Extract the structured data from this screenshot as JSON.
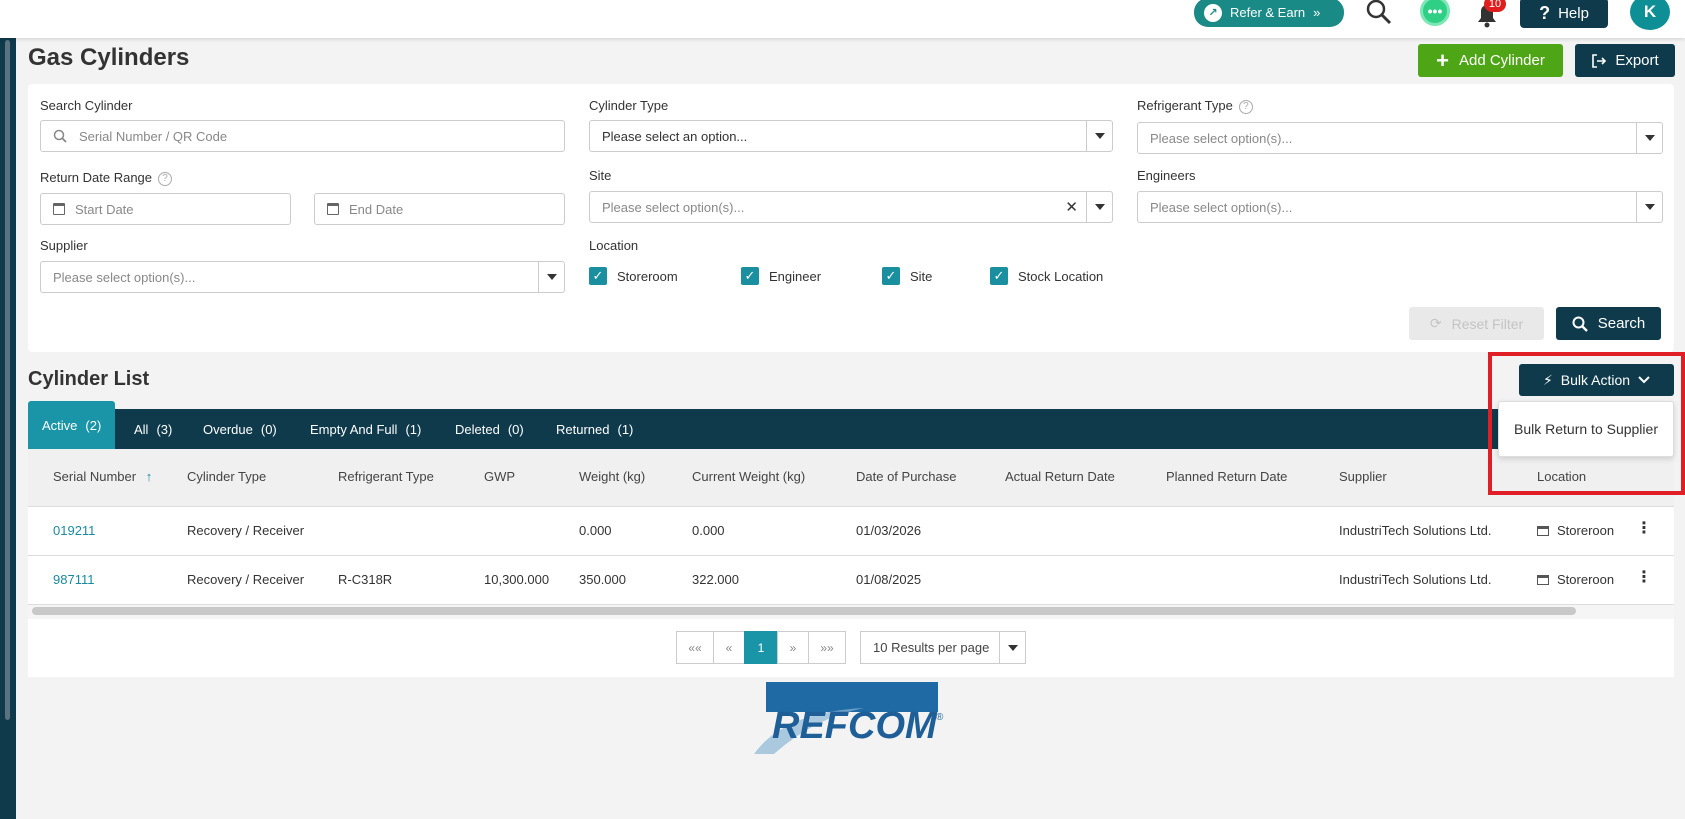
{
  "topbar": {
    "refer_label": "Refer & Earn",
    "refer_chevron": "»",
    "notification_count": "10",
    "help_label": "Help",
    "avatar_initial": "K"
  },
  "page": {
    "title": "Gas Cylinders",
    "add_label": "Add Cylinder",
    "export_label": "Export"
  },
  "filters": {
    "search_label": "Search Cylinder",
    "search_placeholder": "Serial Number / QR Code",
    "cylinder_type_label": "Cylinder Type",
    "cylinder_type_placeholder": "Please select an option...",
    "refrigerant_type_label": "Refrigerant Type",
    "refrigerant_type_placeholder": "Please select option(s)...",
    "return_date_label": "Return Date Range",
    "start_date_placeholder": "Start Date",
    "end_date_placeholder": "End Date",
    "site_label": "Site",
    "site_placeholder": "Please select option(s)...",
    "engineers_label": "Engineers",
    "engineers_placeholder": "Please select option(s)...",
    "supplier_label": "Supplier",
    "supplier_placeholder": "Please select option(s)...",
    "location_label": "Location",
    "locations": [
      "Storeroom",
      "Engineer",
      "Site",
      "Stock Location"
    ],
    "reset_label": "Reset Filter",
    "search_button_label": "Search"
  },
  "list": {
    "title": "Cylinder List",
    "bulk_action_label": "Bulk Action",
    "bulk_menu_item": "Bulk Return to Supplier",
    "tabs": [
      {
        "label": "Active",
        "count": "(2)"
      },
      {
        "label": "All",
        "count": "(3)"
      },
      {
        "label": "Overdue",
        "count": "(0)"
      },
      {
        "label": "Empty And Full",
        "count": "(1)"
      },
      {
        "label": "Deleted",
        "count": "(0)"
      },
      {
        "label": "Returned",
        "count": "(1)"
      }
    ],
    "columns": [
      "Serial Number",
      "Cylinder Type",
      "Refrigerant Type",
      "GWP",
      "Weight (kg)",
      "Current Weight (kg)",
      "Date of Purchase",
      "Actual Return Date",
      "Planned Return Date",
      "Supplier",
      "Location"
    ],
    "rows": [
      {
        "serial": "019211",
        "cylinder_type": "Recovery / Receiver",
        "refrigerant": "",
        "gwp": "",
        "weight": "0.000",
        "current_weight": "0.000",
        "purchase_date": "01/03/2026",
        "actual_return": "",
        "planned_return": "",
        "supplier": "IndustriTech Solutions Ltd.",
        "location": "Storeroon"
      },
      {
        "serial": "987111",
        "cylinder_type": "Recovery / Receiver",
        "refrigerant": "R-C318R",
        "gwp": "10,300.000",
        "weight": "350.000",
        "current_weight": "322.000",
        "purchase_date": "01/08/2025",
        "actual_return": "",
        "planned_return": "",
        "supplier": "IndustriTech Solutions Ltd.",
        "location": "Storeroon"
      }
    ]
  },
  "pagination": {
    "first": "««",
    "prev": "«",
    "current": "1",
    "next": "»",
    "last": "»»",
    "per_page": "10 Results per page"
  },
  "logo": {
    "text": "REFCOM",
    "registered": "®"
  },
  "colors": {
    "brand_dark": "#0e3a4c",
    "accent_teal": "#1a95a8",
    "add_green": "#4ea516",
    "highlight_red": "#e01e26"
  }
}
